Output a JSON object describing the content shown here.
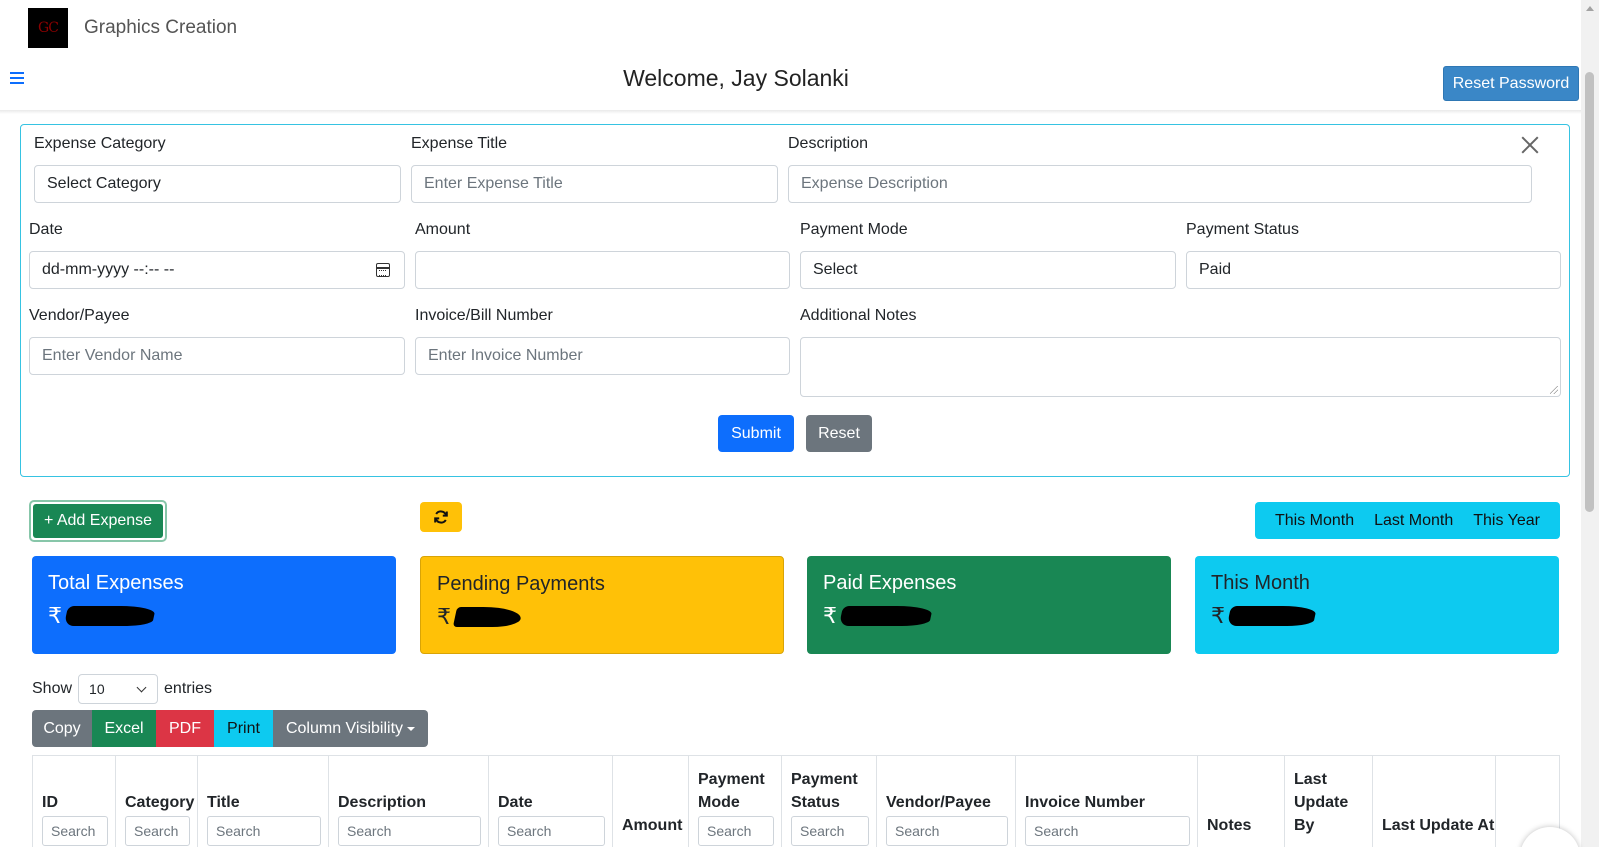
{
  "header": {
    "brand_name": "Graphics Creation",
    "logo_text": "GC",
    "welcome": "Welcome, Jay Solanki",
    "reset_password_label": "Reset Password"
  },
  "form": {
    "expense_category": {
      "label": "Expense Category",
      "value": "Select Category"
    },
    "expense_title": {
      "label": "Expense Title",
      "placeholder": "Enter Expense Title"
    },
    "description": {
      "label": "Description",
      "placeholder": "Expense Description"
    },
    "date": {
      "label": "Date",
      "value": "dd-mm-yyyy --:-- --"
    },
    "amount": {
      "label": "Amount",
      "value": ""
    },
    "payment_mode": {
      "label": "Payment Mode",
      "value": "Select"
    },
    "payment_status": {
      "label": "Payment Status",
      "value": "Paid"
    },
    "vendor": {
      "label": "Vendor/Payee",
      "placeholder": "Enter Vendor Name"
    },
    "invoice": {
      "label": "Invoice/Bill Number",
      "placeholder": "Enter Invoice Number"
    },
    "notes": {
      "label": "Additional Notes",
      "value": ""
    },
    "submit_label": "Submit",
    "reset_label": "Reset"
  },
  "actions": {
    "add_expense_label": "+ Add Expense",
    "periods": [
      "This Month",
      "Last Month",
      "This Year"
    ]
  },
  "cards": [
    {
      "title": "Total Expenses",
      "currency": "₹",
      "color": "#0d6efd",
      "text_color": "#ffffff"
    },
    {
      "title": "Pending Payments",
      "currency": "₹",
      "color": "#ffc107",
      "text_color": "#212529"
    },
    {
      "title": "Paid Expenses",
      "currency": "₹",
      "color": "#198754",
      "text_color": "#ffffff"
    },
    {
      "title": "This Month",
      "currency": "₹",
      "color": "#0dcaf0",
      "text_color": "#212529"
    }
  ],
  "table_controls": {
    "show_label": "Show",
    "page_length": "10",
    "entries_label": "entries",
    "exports": [
      {
        "label": "Copy",
        "color": "#6c757d"
      },
      {
        "label": "Excel",
        "color": "#198754"
      },
      {
        "label": "PDF",
        "color": "#dc3545"
      },
      {
        "label": "Print",
        "color": "#0dcaf0"
      },
      {
        "label": "Column Visibility",
        "color": "#6c757d"
      }
    ]
  },
  "table": {
    "search_placeholder": "Search",
    "columns": [
      {
        "line1": "",
        "line2": "",
        "line3": "ID",
        "searchable": true
      },
      {
        "line1": "",
        "line2": "",
        "line3": "Category",
        "searchable": true
      },
      {
        "line1": "",
        "line2": "",
        "line3": "Title",
        "searchable": true
      },
      {
        "line1": "",
        "line2": "",
        "line3": "Description",
        "searchable": true
      },
      {
        "line1": "",
        "line2": "",
        "line3": "Date",
        "searchable": true
      },
      {
        "line1": "",
        "line2": "",
        "line3": "Amount",
        "searchable": false
      },
      {
        "line1": "",
        "line2": "Payment",
        "line3": "Mode",
        "searchable": true
      },
      {
        "line1": "",
        "line2": "Payment",
        "line3": "Status",
        "searchable": true
      },
      {
        "line1": "",
        "line2": "",
        "line3": "Vendor/Payee",
        "searchable": true
      },
      {
        "line1": "",
        "line2": "",
        "line3": "Invoice Number",
        "searchable": true
      },
      {
        "line1": "",
        "line2": "",
        "line3": "Notes",
        "searchable": false
      },
      {
        "line1": "Last",
        "line2": "Update",
        "line3": "By",
        "searchable": false
      },
      {
        "line1": "",
        "line2": "",
        "line3": "Last Update At",
        "searchable": false
      }
    ]
  }
}
